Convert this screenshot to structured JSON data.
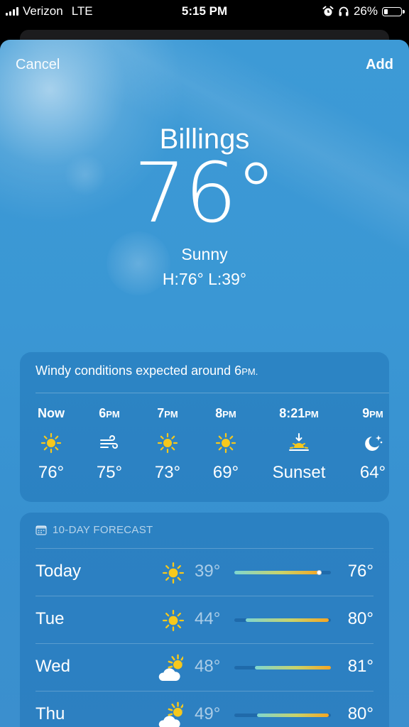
{
  "status_bar": {
    "carrier": "Verizon",
    "network": "LTE",
    "time": "5:15 PM",
    "battery_percent": "26%",
    "battery_level": 0.26
  },
  "nav": {
    "cancel_label": "Cancel",
    "add_label": "Add"
  },
  "current": {
    "city": "Billings",
    "temperature": "76°",
    "condition": "Sunny",
    "high_low": "H:76°  L:39°"
  },
  "hourly": {
    "note_prefix": "Windy conditions expected around 6",
    "note_suffix": "PM.",
    "items": [
      {
        "time": "Now",
        "suffix": "",
        "icon": "sun-icon",
        "temp": "76°"
      },
      {
        "time": "6",
        "suffix": "PM",
        "icon": "wind-icon",
        "temp": "75°"
      },
      {
        "time": "7",
        "suffix": "PM",
        "icon": "sun-icon",
        "temp": "73°"
      },
      {
        "time": "8",
        "suffix": "PM",
        "icon": "sun-icon",
        "temp": "69°"
      },
      {
        "time": "8:21",
        "suffix": "PM",
        "icon": "sunset-icon",
        "temp": "Sunset"
      },
      {
        "time": "9",
        "suffix": "PM",
        "icon": "moon-stars-icon",
        "temp": "64°"
      }
    ]
  },
  "forecast": {
    "header": "10-DAY FORECAST",
    "range_min": 39,
    "range_max": 81,
    "days": [
      {
        "day": "Today",
        "icon": "sun-icon",
        "low": "39°",
        "high": "76°",
        "low_val": 39,
        "high_val": 76,
        "current_val": 76
      },
      {
        "day": "Tue",
        "icon": "sun-icon",
        "low": "44°",
        "high": "80°",
        "low_val": 44,
        "high_val": 80
      },
      {
        "day": "Wed",
        "icon": "partly-cloudy-icon",
        "low": "48°",
        "high": "81°",
        "low_val": 48,
        "high_val": 81
      },
      {
        "day": "Thu",
        "icon": "partly-cloudy-icon",
        "low": "49°",
        "high": "80°",
        "low_val": 49,
        "high_val": 80
      }
    ]
  },
  "colors": {
    "sky": "#3a97d4",
    "sun": "#f6c81c",
    "bar_cool": "#7fd6d0",
    "bar_warm": "#f5a623"
  }
}
